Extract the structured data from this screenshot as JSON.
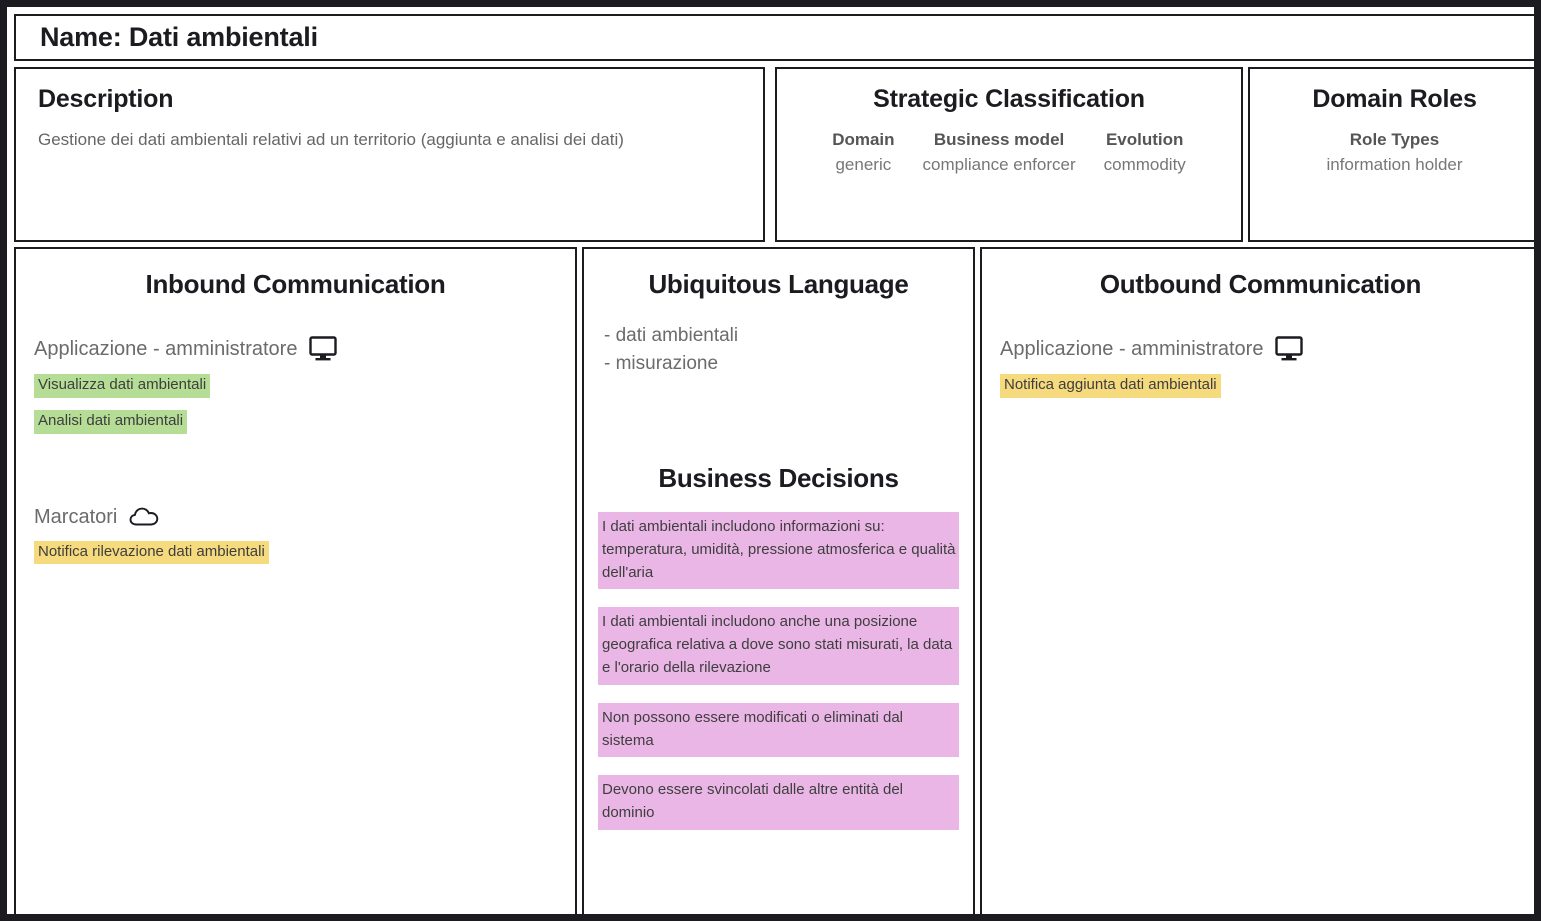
{
  "header": {
    "name_label": "Name: Dati ambientali"
  },
  "description": {
    "title": "Description",
    "body": "Gestione dei dati ambientali relativi ad un territorio (aggiunta e analisi dei dati)"
  },
  "strategic_classification": {
    "title": "Strategic Classification",
    "fields": [
      {
        "label": "Domain",
        "value": "generic"
      },
      {
        "label": "Business model",
        "value": "compliance enforcer"
      },
      {
        "label": "Evolution",
        "value": "commodity"
      }
    ]
  },
  "domain_roles": {
    "title": "Domain Roles",
    "label": "Role Types",
    "value": "information holder"
  },
  "inbound": {
    "title": "Inbound Communication",
    "groups": [
      {
        "actor": "Applicazione - amministratore",
        "icon": "monitor-icon",
        "messages": [
          {
            "text": "Visualizza dati ambientali",
            "color": "green"
          },
          {
            "text": "Analisi dati ambientali",
            "color": "green"
          }
        ]
      },
      {
        "actor": "Marcatori",
        "icon": "cloud-icon",
        "messages": [
          {
            "text": "Notifica rilevazione dati ambientali",
            "color": "yellow"
          }
        ]
      }
    ]
  },
  "ubiquitous_language": {
    "title": "Ubiquitous Language",
    "terms": [
      "- dati ambientali",
      "- misurazione"
    ]
  },
  "business_decisions": {
    "title": "Business Decisions",
    "items": [
      "I dati ambientali includono informazioni su: temperatura, umidità, pressione atmosferica e qualità dell'aria",
      "I dati ambientali includono anche una posizione geografica relativa a dove sono stati misurati, la data e l'orario della rilevazione",
      "Non possono essere modificati o eliminati dal sistema",
      "Devono essere svincolati dalle altre entità del dominio"
    ]
  },
  "outbound": {
    "title": "Outbound Communication",
    "groups": [
      {
        "actor": "Applicazione - amministratore",
        "icon": "monitor-icon",
        "messages": [
          {
            "text": "Notifica aggiunta dati ambientali",
            "color": "yellow"
          }
        ]
      }
    ]
  },
  "colors": {
    "green_chip": "#b5dd96",
    "yellow_chip": "#f6da7e",
    "purple_card": "#eab6e6",
    "border": "#1b1b20"
  }
}
